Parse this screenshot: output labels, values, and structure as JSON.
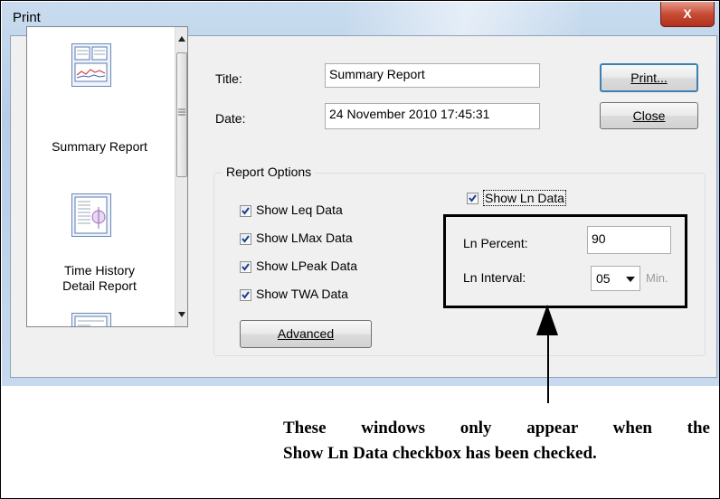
{
  "window": {
    "title": "Print",
    "close_label": "X"
  },
  "report_list": {
    "items": [
      {
        "label": "Summary Report"
      },
      {
        "label_line1": "Time History",
        "label_line2": "Detail Report"
      }
    ]
  },
  "form": {
    "title_label": "Title:",
    "title_value": "Summary Report",
    "date_label": "Date:",
    "date_value": "24 November 2010 17:45:31"
  },
  "buttons": {
    "print": "Print...",
    "close": "Close",
    "advanced": "Advanced"
  },
  "report_options": {
    "group_label": "Report Options",
    "checkboxes": [
      {
        "label": "Show Leq Data",
        "checked": true
      },
      {
        "label": "Show LMax Data",
        "checked": true
      },
      {
        "label": "Show LPeak Data",
        "checked": true
      },
      {
        "label": "Show TWA Data",
        "checked": true
      }
    ],
    "show_ln": {
      "label": "Show Ln Data",
      "checked": true
    },
    "ln_percent_label": "Ln Percent:",
    "ln_percent_value": "90",
    "ln_interval_label": "Ln Interval:",
    "ln_interval_value": "05",
    "ln_interval_unit": "Min."
  },
  "annotation": {
    "line1": "These windows only appear when the",
    "line2": "Show Ln Data checkbox has been checked."
  },
  "colors": {
    "window_frame": "#c9dcef",
    "close_button": "#c74c36",
    "client_bg": "#f0f0f0"
  }
}
